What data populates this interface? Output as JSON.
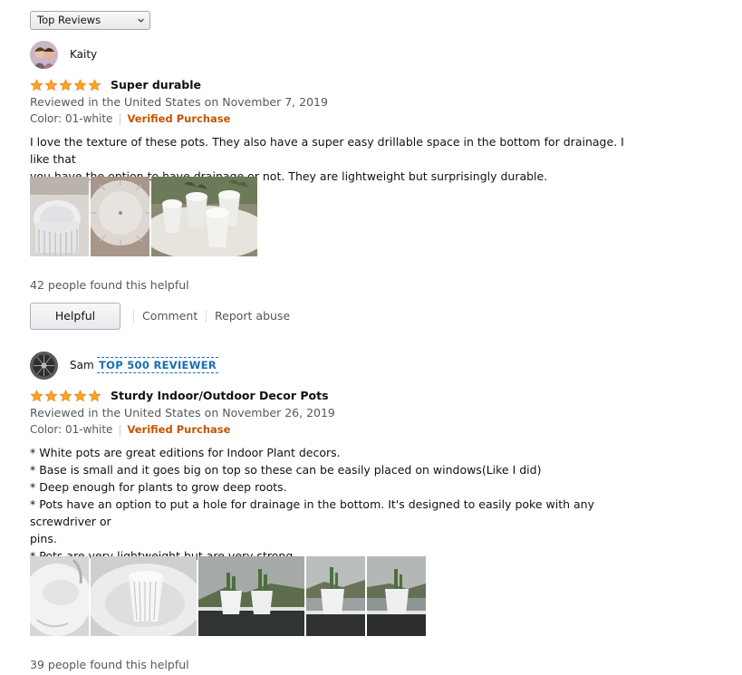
{
  "sort": {
    "label": "Top Reviews"
  },
  "reviews": [
    {
      "name": "Kaity",
      "title": "Super durable",
      "stars": 5,
      "date": "Reviewed in the United States on November 7, 2019",
      "variant": "Color: 01-white",
      "verified": "Verified Purchase",
      "body": [
        "I love the texture of these pots. They also have a super easy drillable space in the bottom for drainage. I like that",
        "you have the option to have drainage or not. They are lightweight but surprisingly durable."
      ],
      "helpful_count": "42 people found this helpful",
      "helpful_label": "Helpful",
      "comment_label": "Comment",
      "report_label": "Report abuse"
    },
    {
      "name": "Sam",
      "badge": "TOP 500 REVIEWER",
      "title": "Sturdy Indoor/Outdoor Decor Pots",
      "stars": 5,
      "date": "Reviewed in the United States on November 26, 2019",
      "variant": "Color: 01-white",
      "verified": "Verified Purchase",
      "body": [
        "* White pots are great editions for Indoor Plant decors.",
        "* Base is small and it goes big on top so these can be easily placed on windows(Like I did)",
        "* Deep enough for plants to grow deep roots.",
        "* Pots have an option to put a hole for drainage in the bottom. It's designed to easily poke with any screwdriver or",
        "pins.",
        "* Pots are very lightweight but are very strong."
      ],
      "helpful_count": "39 people found this helpful"
    }
  ],
  "colors": {
    "star": "#ffa41c",
    "star_stroke": "#de7921",
    "verified": "#c45500",
    "badge": "#146eb4"
  }
}
